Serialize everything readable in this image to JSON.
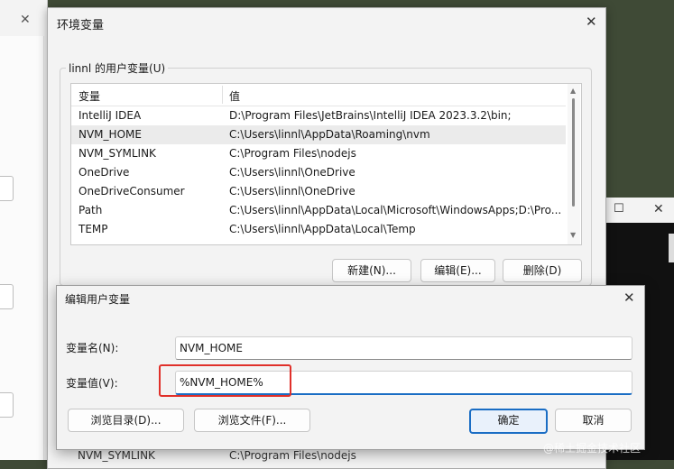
{
  "env_dialog": {
    "title": "环境变量",
    "group_label": "linnl 的用户变量(U)",
    "columns": [
      "变量",
      "值"
    ],
    "rows": [
      {
        "name": "IntelliJ IDEA",
        "value": "D:\\Program Files\\JetBrains\\IntelliJ IDEA 2023.3.2\\bin;"
      },
      {
        "name": "NVM_HOME",
        "value": "C:\\Users\\linnl\\AppData\\Roaming\\nvm"
      },
      {
        "name": "NVM_SYMLINK",
        "value": "C:\\Program Files\\nodejs"
      },
      {
        "name": "OneDrive",
        "value": "C:\\Users\\linnl\\OneDrive"
      },
      {
        "name": "OneDriveConsumer",
        "value": "C:\\Users\\linnl\\OneDrive"
      },
      {
        "name": "Path",
        "value": "C:\\Users\\linnl\\AppData\\Local\\Microsoft\\WindowsApps;D:\\Pro..."
      },
      {
        "name": "TEMP",
        "value": "C:\\Users\\linnl\\AppData\\Local\\Temp"
      }
    ],
    "selected_row": "NVM_HOME",
    "buttons": {
      "new": "新建(N)...",
      "edit": "编辑(E)...",
      "delete": "删除(D)"
    },
    "behind_row": {
      "name": "NVM_SYMLINK",
      "value": "C:\\Program Files\\nodejs"
    }
  },
  "edit_dialog": {
    "title": "编辑用户变量",
    "name_label": "变量名(N):",
    "name_value": "NVM_HOME",
    "value_label": "变量值(V):",
    "value_value": "%NVM_HOME%",
    "buttons": {
      "browse_dir": "浏览目录(D)...",
      "browse_file": "浏览文件(F)...",
      "ok": "确定",
      "cancel": "取消"
    }
  },
  "watermark": "@稀土掘金技术社区",
  "icons": {
    "close": "close-icon",
    "maximize": "maximize-icon"
  },
  "colors": {
    "accent": "#1a6dc4",
    "highlight": "#e0302a",
    "selected_row": "#ebebeb"
  }
}
